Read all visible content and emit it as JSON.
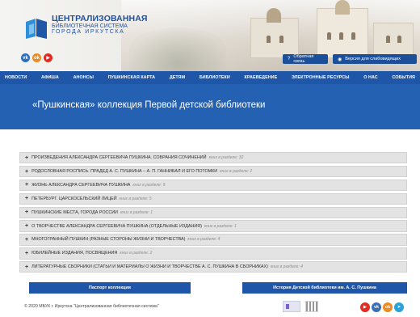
{
  "logo": {
    "line1": "ЦЕНТРАЛИЗОВАННАЯ",
    "line2": "БИБЛИОТЕЧНАЯ СИСТЕМА",
    "line3": "ГОРОДА ИРКУТСКА"
  },
  "header": {
    "feedback_label": "Обратная связь",
    "vision_label": "Версия для слабовидящих",
    "feedback_icon": "question-icon",
    "vision_icon": "eye-icon"
  },
  "socials": [
    "vk",
    "ok",
    "youtube"
  ],
  "nav": {
    "items": [
      "НОВОСТИ",
      "АФИША",
      "АНОНСЫ",
      "ПУШКИНСКАЯ КАРТА",
      "ДЕТЯМ",
      "БИБЛИОТЕКИ",
      "КРАЕВЕДЕНИЕ",
      "ЭЛЕКТРОННЫЕ РЕСУРСЫ",
      "О НАС",
      "СОБЫТИЯ"
    ]
  },
  "banner": {
    "title": "«Пушкинская» коллекция Первой детской библиотеки"
  },
  "accordion": {
    "items": [
      {
        "title": "ПРОИЗВЕДЕНИЯ АЛЕКСАНДРА СЕРГЕЕВИЧА ПУШКИНА. СОБРАНИЯ СОЧИНЕНИЙ",
        "meta": "книг в разделе: 32"
      },
      {
        "title": "РОДОСЛОВНАЯ РОСПИСЬ. ПРАДЕД А. С. ПУШКИНА – А. П. ГАННИБАЛ И ЕГО ПОТОМКИ",
        "meta": "книг в разделе: 2"
      },
      {
        "title": "ЖИЗНЬ АЛЕКСАНДРА СЕРГЕЕВИЧА ПУШКИНА",
        "meta": "книг в разделе: 9"
      },
      {
        "title": "ПЕТЕРБУРГ. ЦАРСКОСЕЛЬСКИЙ ЛИЦЕЙ",
        "meta": "книг в разделе: 5"
      },
      {
        "title": "ПУШКИНСКИЕ МЕСТА, ГОРОДА РОССИИ",
        "meta": "книг в разделе: 1"
      },
      {
        "title": "О ТВОРЧЕСТВЕ АЛЕКСАНДРА СЕРГЕЕВИЧА ПУШКИНА (ОТДЕЛЬНЫЕ ИЗДАНИЯ)",
        "meta": "книг в разделе: 1"
      },
      {
        "title": "МНОГОГРАННЫЙ ПУШКИН (РАЗНЫЕ СТОРОНЫ ЖИЗНИ И ТВОРЧЕСТВА)",
        "meta": "книг в разделе: 4"
      },
      {
        "title": "ЮБИЛЕЙНЫЕ ИЗДАНИЯ, ПОСВЯЩЕНИЯ",
        "meta": "книг в разделе: 2"
      },
      {
        "title": "ЛИТЕРАТУРНЫЕ СБОРНИКИ (СТАТЬИ И МАТЕРИАЛЫ О ЖИЗНИ И ТВОРЧЕСТВЕ А. С. ПУШКИНА В СБОРНИКАХ)",
        "meta": "книг в разделе: 4"
      }
    ]
  },
  "buttons": {
    "passport": "Паспорт коллекции",
    "history": "История Детской библиотеки им. А. С. Пушкина"
  },
  "footer": {
    "copyright": "© 2020 МБУК г. Иркутска \"Централизованная библиотечная система\""
  },
  "colors": {
    "brand_blue": "#1f56a8",
    "banner_blue": "#2461b3",
    "row_gray": "#e3e3e3"
  }
}
